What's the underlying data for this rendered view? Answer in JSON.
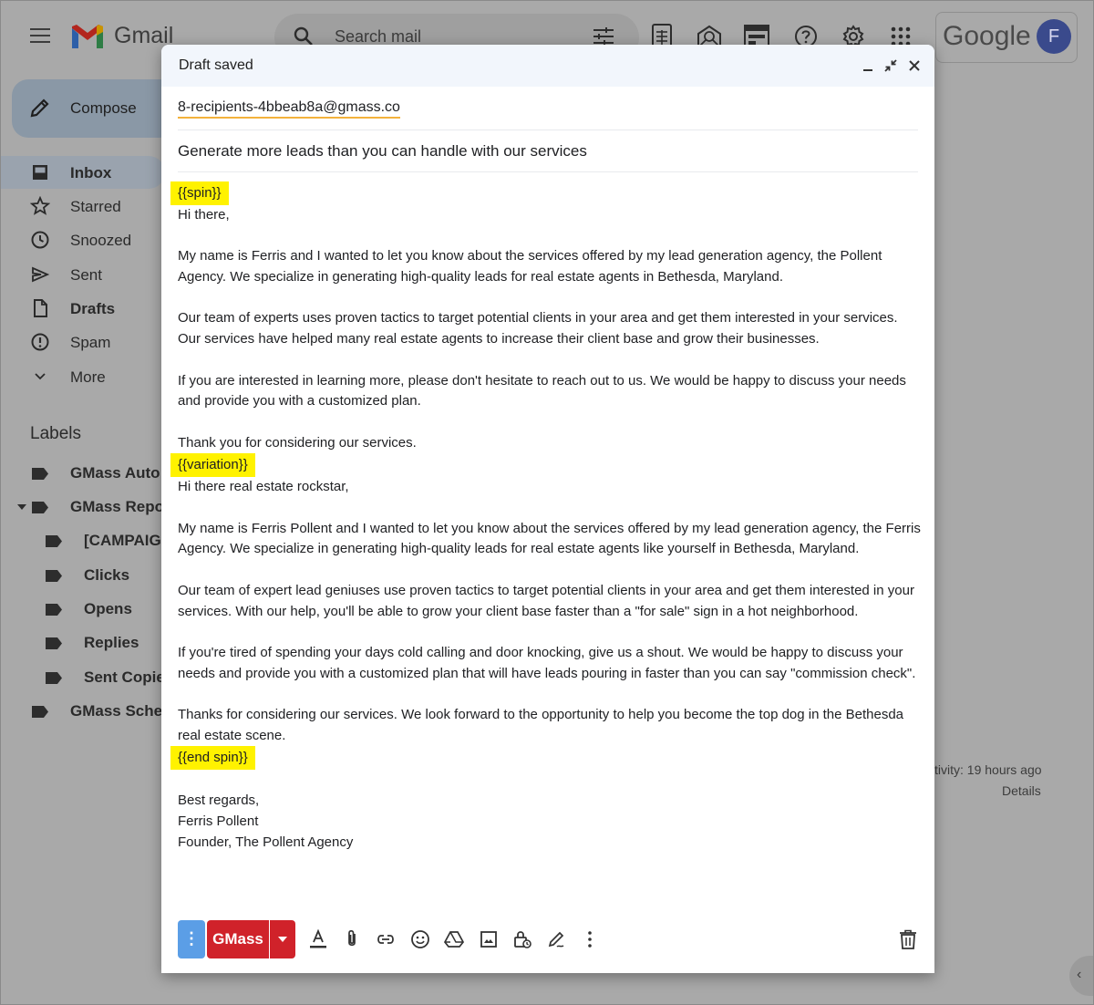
{
  "app": {
    "name": "Gmail",
    "search_placeholder": "Search mail",
    "brand": "Google",
    "avatar_letter": "F"
  },
  "sidebar": {
    "compose_label": "Compose",
    "items": [
      {
        "label": "Inbox",
        "icon": "inbox-icon",
        "active": true
      },
      {
        "label": "Starred",
        "icon": "star-icon"
      },
      {
        "label": "Snoozed",
        "icon": "clock-icon"
      },
      {
        "label": "Sent",
        "icon": "send-icon"
      },
      {
        "label": "Drafts",
        "icon": "draft-icon"
      },
      {
        "label": "Spam",
        "icon": "spam-icon"
      },
      {
        "label": "More",
        "icon": "chevron-down-icon"
      }
    ],
    "labels_heading": "Labels",
    "labels": [
      {
        "label": "GMass Auto"
      },
      {
        "label": "GMass Repo"
      },
      {
        "label": "[CAMPAIG"
      },
      {
        "label": "Clicks"
      },
      {
        "label": "Opens"
      },
      {
        "label": "Replies"
      },
      {
        "label": "Sent Copie"
      },
      {
        "label": "GMass Sche"
      }
    ]
  },
  "background": {
    "activity": "tivity: 19 hours ago",
    "details": "Details"
  },
  "compose": {
    "title": "Draft saved",
    "to": "8-recipients-4bbeab8a@gmass.co",
    "subject": "Generate more leads than you can handle with our services",
    "body": {
      "spin_open": "{{spin}}",
      "v1_greeting": "Hi there,",
      "v1_p1": "My name is Ferris and I wanted to let you know about the services offered by my lead generation agency, the Pollent Agency. We specialize in generating high-quality leads for real estate agents in Bethesda, Maryland.",
      "v1_p2": "Our team of experts uses proven tactics to target potential clients in your area and get them interested in your services. Our services have helped many real estate agents to increase their client base and grow their businesses.",
      "v1_p3": "If you are interested in learning more, please don't hesitate to reach out to us. We would be happy to discuss your needs and provide you with a customized plan.",
      "v1_close": "Thank you for considering our services.",
      "variation": "{{variation}}",
      "v2_greeting": "Hi there real estate rockstar,",
      "v2_p1": "My name is Ferris Pollent and I wanted to let you know about the services offered by my lead generation agency, the Ferris Agency. We specialize in generating high-quality leads for real estate agents like yourself in Bethesda, Maryland.",
      "v2_p2": "Our team of expert lead geniuses use proven tactics to target potential clients in your area and get them interested in your services. With our help, you'll be able to grow your client base faster than a \"for sale\" sign in a hot neighborhood.",
      "v2_p3": "If you're tired of spending your days cold calling and door knocking, give us a shout. We would be happy to discuss your needs and provide you with a customized plan that will have leads pouring in faster than you can say \"commission check\".",
      "v2_close": "Thanks for considering our services. We look forward to the opportunity to help you become the top dog in the Bethesda real estate scene.",
      "spin_close": "{{end spin}}",
      "sign_off": "Best regards,",
      "sig_name": "Ferris Pollent",
      "sig_title": "Founder, The Pollent Agency"
    },
    "toolbar": {
      "more_options": "⋮",
      "gmass_label": "GMass",
      "icons": [
        "format-text-icon",
        "attach-icon",
        "link-icon",
        "emoji-icon",
        "drive-icon",
        "image-icon",
        "confidential-icon",
        "signature-icon",
        "more-vert-icon",
        "trash-icon"
      ]
    }
  },
  "colors": {
    "highlight": "#fff200",
    "gmass_red": "#d0222a",
    "options_blue": "#5b9ee6",
    "header_bg": "#f2f6fc"
  }
}
